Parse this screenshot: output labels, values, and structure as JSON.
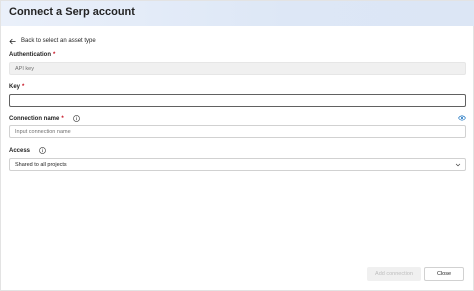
{
  "dialog": {
    "title": "Connect a Serp account",
    "back_link": "Back to select an asset type"
  },
  "authentication": {
    "label": "Authentication",
    "required_mark": "*",
    "value": "API key"
  },
  "key": {
    "label": "Key",
    "required_mark": "*",
    "value": ""
  },
  "connection_name": {
    "label": "Connection name",
    "required_mark": "*",
    "placeholder": "Input connection name"
  },
  "access": {
    "label": "Access",
    "value": "Shared to all projects"
  },
  "buttons": {
    "add": "Add connection",
    "close": "Close"
  },
  "colors": {
    "header_bg": "#dde7f6",
    "required": "#c50f1f",
    "accent": "#0f6cbd"
  }
}
